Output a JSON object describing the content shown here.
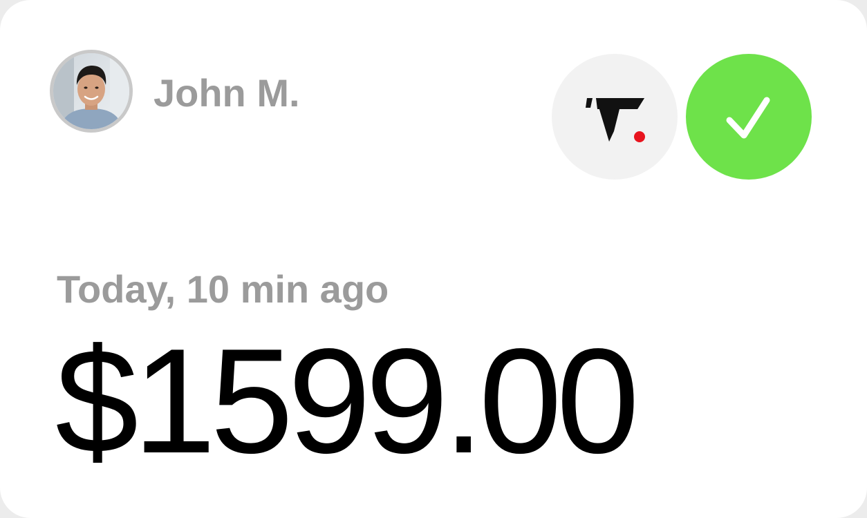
{
  "user": {
    "name": "John M.",
    "avatar_icon": "user-photo"
  },
  "merchant": {
    "logo_icon": "brand-logo-icon",
    "logo_color": "#111111",
    "logo_dot_color": "#e8141e",
    "badge_bg": "#f2f2f2"
  },
  "status": {
    "icon": "checkmark-icon",
    "color": "#6ee24a"
  },
  "transaction": {
    "timestamp": "Today, 10 min ago",
    "amount": "$1599.00"
  }
}
